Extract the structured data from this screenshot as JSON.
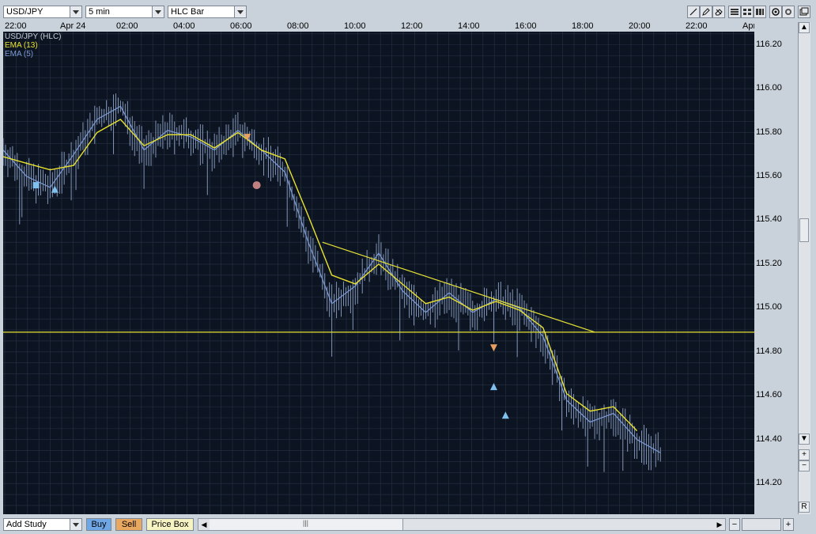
{
  "toolbar": {
    "symbol": "USD/JPY",
    "interval": "5 min",
    "chart_type": "HLC Bar",
    "right_icons": [
      "line-tool-icon",
      "pencil-icon",
      "eraser-icon",
      "grid-icon",
      "grid-icon",
      "grid-icon",
      "zoom-icon",
      "settings-icon",
      "window-icon"
    ]
  },
  "legend": {
    "series1": "USD/JPY (HLC)",
    "series2": "EMA (13)",
    "series3": "EMA (5)"
  },
  "colors": {
    "background": "#0c1422",
    "price": "#8ea2c6",
    "ema13": "#e9e22f",
    "ema5": "#7d9bd6",
    "trendline": "#e6e236",
    "grid": "#273244",
    "sell_marker": "#e8a060",
    "buy_marker": "#80c0ee"
  },
  "xaxis_labels": [
    "22:00",
    "Apr 24",
    "02:00",
    "04:00",
    "06:00",
    "08:00",
    "10:00",
    "12:00",
    "14:00",
    "16:00",
    "18:00",
    "20:00",
    "22:00",
    "Apr"
  ],
  "bottom": {
    "add_study": "Add Study",
    "buy": "Buy",
    "sell": "Sell",
    "price_box": "Price Box",
    "vmenu": "R"
  },
  "chart_data": {
    "type": "line",
    "title": "",
    "xlabel": "",
    "ylabel": "",
    "yticks": [
      114.2,
      114.4,
      114.6,
      114.8,
      115.0,
      115.2,
      115.4,
      115.6,
      115.8,
      116.0,
      116.2
    ],
    "ylim": [
      114.06,
      116.26
    ],
    "grid": true,
    "x": [
      0,
      10,
      20,
      30,
      40,
      50,
      60,
      70,
      80,
      90,
      100,
      110,
      120,
      130,
      140,
      150,
      160,
      170,
      180,
      190,
      200,
      210,
      220,
      230,
      240,
      250,
      260,
      270,
      280
    ],
    "series": [
      {
        "name": "EMA (13)",
        "values": [
          115.69,
          115.66,
          115.63,
          115.65,
          115.8,
          115.86,
          115.74,
          115.79,
          115.79,
          115.73,
          115.8,
          115.72,
          115.68,
          115.42,
          115.15,
          115.11,
          115.2,
          115.11,
          115.02,
          115.05,
          114.99,
          115.03,
          114.99,
          114.91,
          114.61,
          114.53,
          114.55,
          114.44,
          null
        ]
      },
      {
        "name": "EMA (5)",
        "values": [
          115.72,
          115.6,
          115.55,
          115.7,
          115.86,
          115.92,
          115.72,
          115.81,
          115.78,
          115.72,
          115.81,
          115.72,
          115.62,
          115.3,
          115.02,
          115.1,
          115.25,
          115.08,
          114.98,
          115.07,
          114.98,
          115.04,
          115.0,
          114.87,
          114.58,
          114.48,
          114.52,
          114.4,
          114.34
        ]
      }
    ],
    "trendlines": [
      {
        "from": {
          "x": 136,
          "y": 115.3
        },
        "to": {
          "x": 252,
          "y": 114.89
        }
      },
      {
        "horizontal": true,
        "y": 114.89
      }
    ],
    "markers": [
      {
        "type": "square",
        "x": 14,
        "y": 115.56,
        "color": "#80c0ee"
      },
      {
        "type": "buy",
        "x": 22,
        "y": 115.54
      },
      {
        "type": "sell",
        "x": 104,
        "y": 115.78
      },
      {
        "type": "circle",
        "x": 108,
        "y": 115.56,
        "color": "#c08080"
      },
      {
        "type": "sell",
        "x": 209,
        "y": 114.82
      },
      {
        "type": "buy",
        "x": 209,
        "y": 114.64
      },
      {
        "type": "buy",
        "x": 214,
        "y": 114.51
      }
    ]
  }
}
